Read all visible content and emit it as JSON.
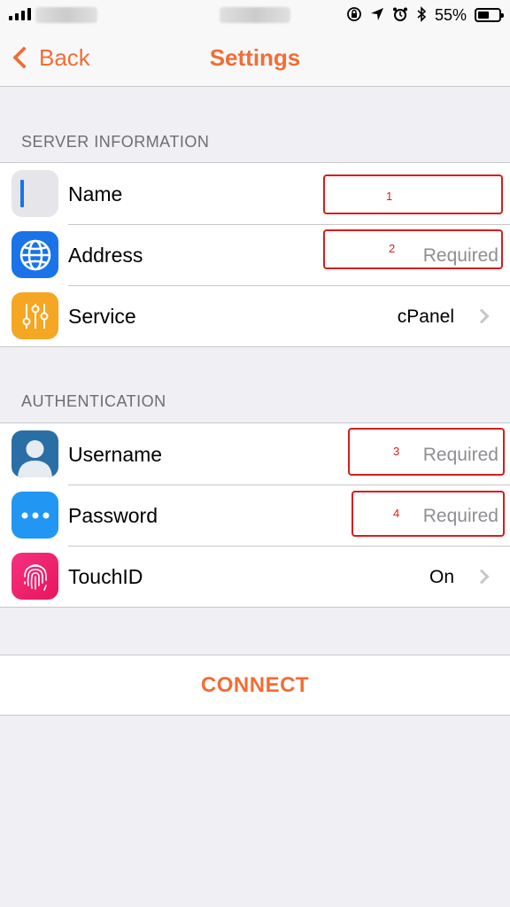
{
  "status_bar": {
    "battery_percent": "55%",
    "battery_level": 0.55,
    "icons": [
      "signal-icon",
      "rotation-lock-icon",
      "location-icon",
      "alarm-icon",
      "bluetooth-icon",
      "battery-icon"
    ]
  },
  "nav": {
    "back_label": "Back",
    "title": "Settings"
  },
  "sections": {
    "server": {
      "header": "SERVER INFORMATION",
      "rows": [
        {
          "label": "Name",
          "value": "",
          "icon": "text-cursor-icon"
        },
        {
          "label": "Address",
          "value": "Required",
          "icon": "globe-icon"
        },
        {
          "label": "Service",
          "value": "cPanel",
          "icon": "sliders-icon"
        }
      ]
    },
    "auth": {
      "header": "AUTHENTICATION",
      "rows": [
        {
          "label": "Username",
          "value": "Required",
          "icon": "user-avatar-icon"
        },
        {
          "label": "Password",
          "value": "Required",
          "icon": "dots-icon"
        },
        {
          "label": "TouchID",
          "value": "On",
          "icon": "fingerprint-icon"
        }
      ]
    }
  },
  "annotations": [
    "1",
    "2",
    "3",
    "4"
  ],
  "connect_label": "CONNECT",
  "colors": {
    "accent": "#f26d35",
    "background": "#efeff4",
    "annotation": "#d81c1c",
    "address_icon": "#1a73e8",
    "service_icon": "#f5a623",
    "password_icon": "#2196f3",
    "touchid_icon": "#f0196b"
  }
}
